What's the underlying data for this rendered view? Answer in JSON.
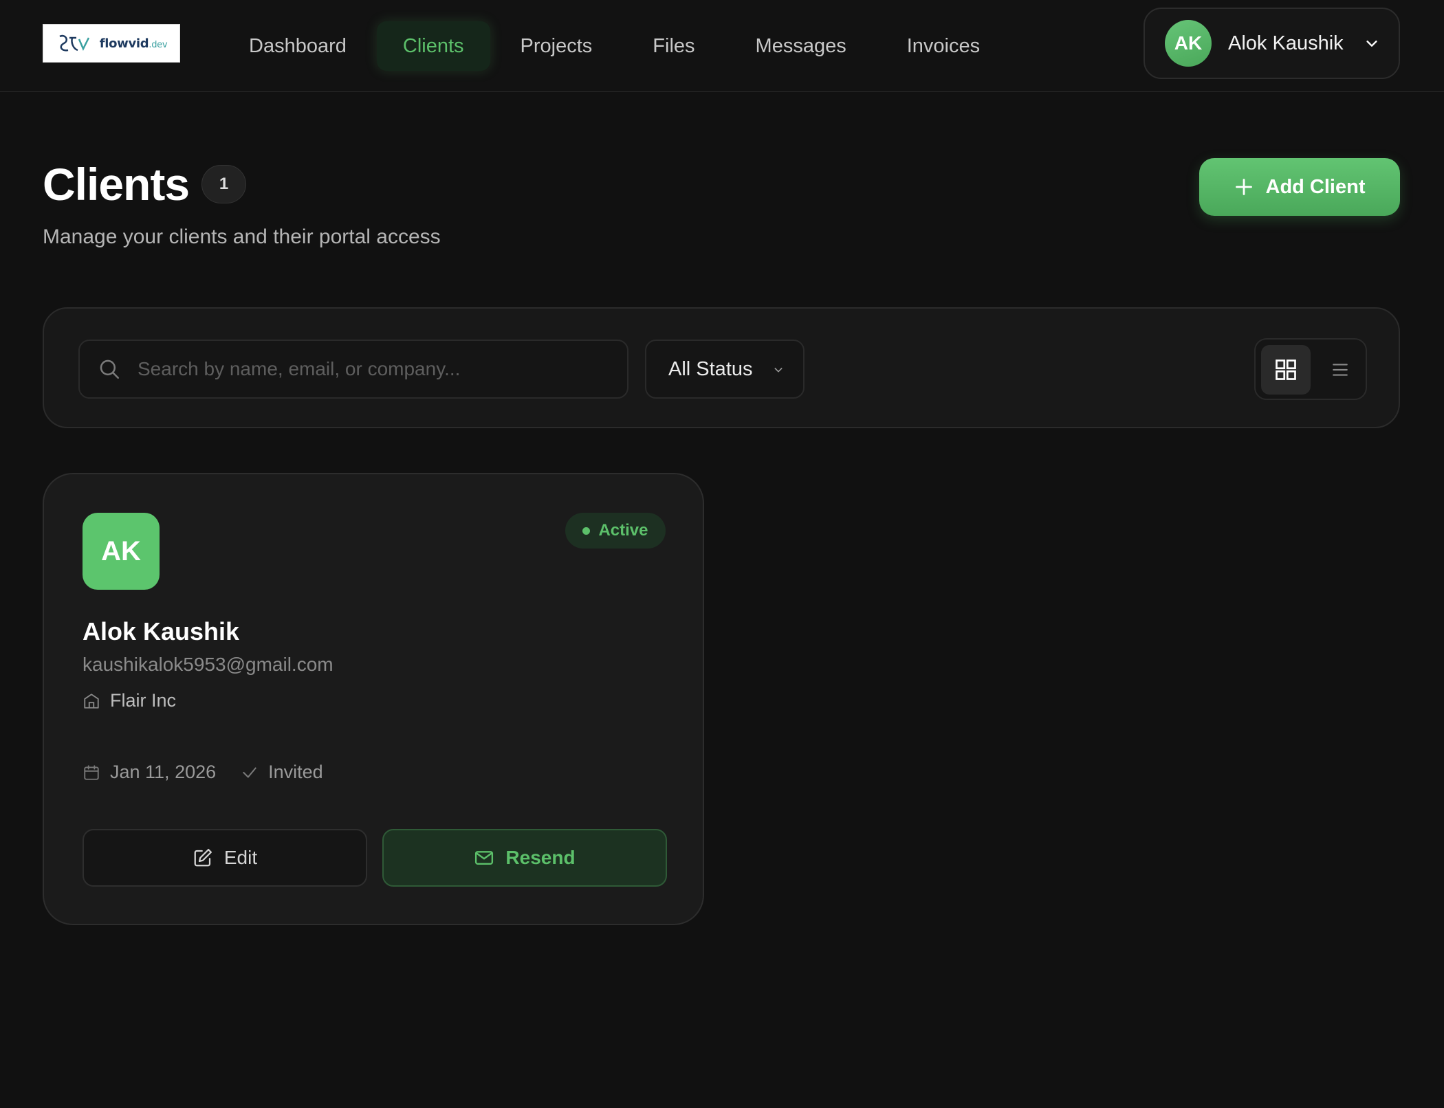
{
  "brand": {
    "logo_text": "flowvid",
    "logo_suffix": ".dev"
  },
  "nav": {
    "items": [
      {
        "label": "Dashboard",
        "active": false
      },
      {
        "label": "Clients",
        "active": true
      },
      {
        "label": "Projects",
        "active": false
      },
      {
        "label": "Files",
        "active": false
      },
      {
        "label": "Messages",
        "active": false
      },
      {
        "label": "Invoices",
        "active": false
      }
    ]
  },
  "user": {
    "initials": "AK",
    "name": "Alok Kaushik",
    "menu_icon": "chevron-down-icon"
  },
  "header": {
    "title": "Clients",
    "count": "1",
    "subtitle": "Manage your clients and their portal access",
    "add_button_label": "Add Client",
    "add_button_icon": "plus-icon"
  },
  "filters": {
    "search_placeholder": "Search by name, email, or company...",
    "search_value": "",
    "status_selected": "All Status",
    "view_mode": "grid"
  },
  "clients": [
    {
      "initials": "AK",
      "status": "Active",
      "name": "Alok Kaushik",
      "email": "kaushikalok5953@gmail.com",
      "company": "Flair Inc",
      "date": "Jan 11, 2026",
      "invite_state": "Invited",
      "edit_label": "Edit",
      "resend_label": "Resend"
    }
  ],
  "colors": {
    "background": "#111111",
    "accent": "#5cc06a",
    "card": "#1b1b1b",
    "border": "#2d2d2d"
  }
}
